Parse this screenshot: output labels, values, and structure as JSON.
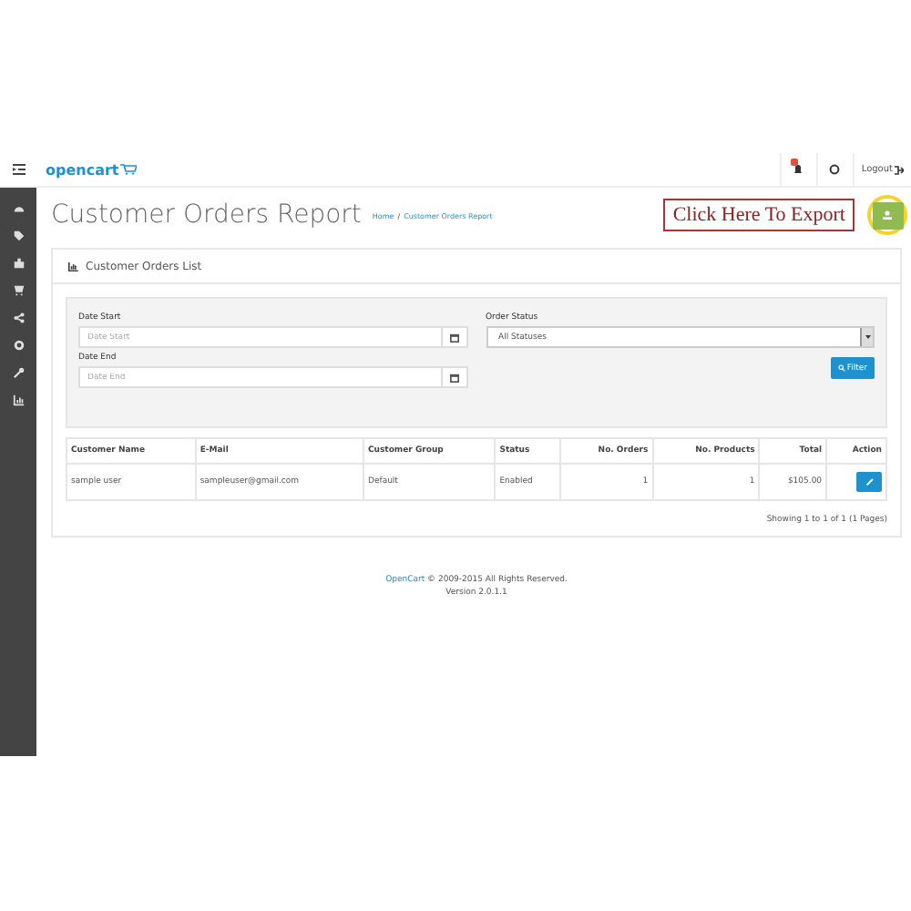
{
  "header": {
    "logo": "opencart",
    "logout": "Logout",
    "notification": {
      "has_badge": true
    }
  },
  "page": {
    "title": "Customer Orders Report",
    "breadcrumb_separator": "/",
    "breadcrumb": [
      {
        "label": "Home"
      },
      {
        "label": "Customer Orders Report"
      }
    ],
    "export_callout": "Click Here To Export"
  },
  "panel": {
    "title": "Customer Orders List",
    "filters": {
      "date_start": {
        "label": "Date Start",
        "placeholder": "Date Start"
      },
      "date_end": {
        "label": "Date End",
        "placeholder": "Date End"
      },
      "order_status": {
        "label": "Order Status",
        "value": "All Statuses"
      },
      "filter_button": "Filter"
    },
    "table": {
      "columns": [
        {
          "label": "Customer Name"
        },
        {
          "label": "E-Mail"
        },
        {
          "label": "Customer Group"
        },
        {
          "label": "Status"
        },
        {
          "label": "No. Orders"
        },
        {
          "label": "No. Products"
        },
        {
          "label": "Total"
        },
        {
          "label": "Action"
        }
      ],
      "rows": [
        {
          "cells": [
            "sample user",
            "sampleuser@gmail.com",
            "Default",
            "Enabled",
            "1",
            "1",
            "$105.00"
          ]
        }
      ]
    },
    "pagination": "Showing 1 to 1 of 1 (1 Pages)"
  },
  "footer": {
    "link": "OpenCart",
    "copyright": " © 2009-2015 All Rights Reserved.",
    "version": "Version 2.0.1.1"
  }
}
